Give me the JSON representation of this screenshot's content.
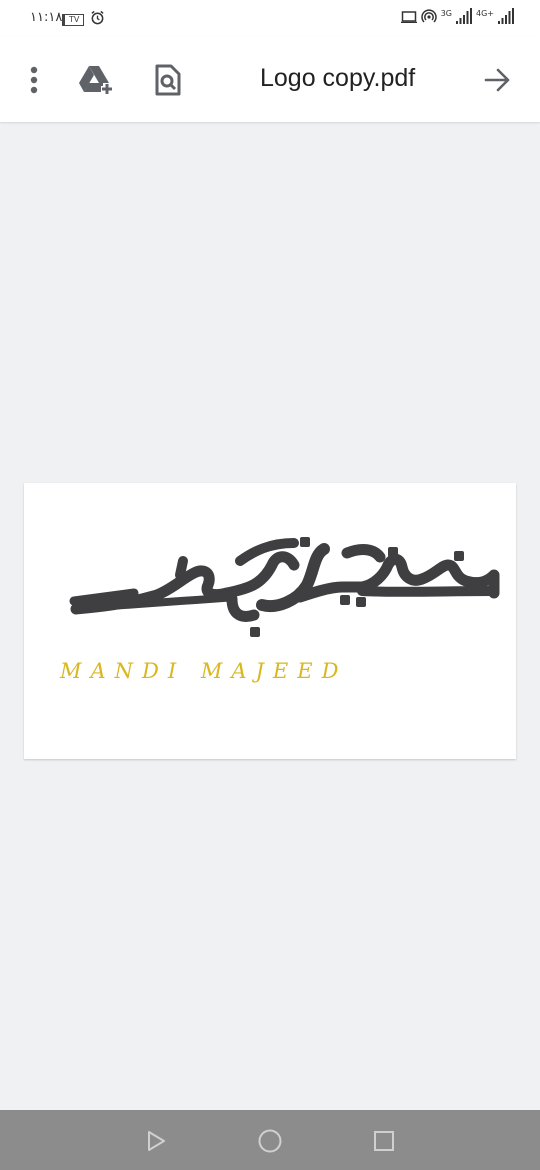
{
  "status_bar": {
    "time": "١١:١٨",
    "tv_badge": "TV",
    "icons": [
      "tv-icon",
      "alarm-icon",
      "cast-icon",
      "hotspot-icon",
      "signal-icon",
      "signal-icon"
    ],
    "network_1": "3G",
    "network_2": "4G+"
  },
  "app_bar": {
    "file_title": "Logo copy.pdf",
    "icons": [
      "more-vert-icon",
      "add-to-drive-icon",
      "find-in-page-icon",
      "arrow-forward-icon"
    ]
  },
  "document": {
    "logo_caption": "MANDI MAJEED",
    "logo_dark_color": "#3f3f41",
    "logo_accent_color": "#d9b81f"
  },
  "nav_bar": {
    "icons": [
      "back-triangle-icon",
      "home-circle-icon",
      "recents-square-icon"
    ]
  }
}
